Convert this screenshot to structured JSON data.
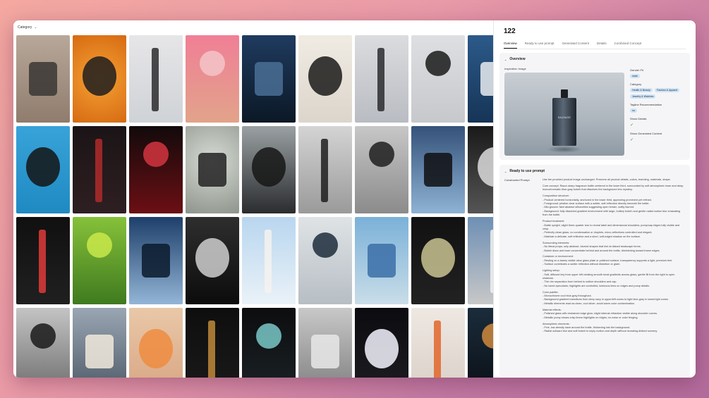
{
  "filter": {
    "label": "Category"
  },
  "tiles": [
    {
      "bg": "linear-gradient(180deg,#b8a89a,#8f7c6d)",
      "obj": "#3a3634"
    },
    {
      "bg": "radial-gradient(circle at 50% 50%,#f6a234,#d66a12)",
      "obj": "#1e1d1e"
    },
    {
      "bg": "linear-gradient(180deg,#e6e6e8,#cfd2d6)",
      "obj": "#2c2c2e"
    },
    {
      "bg": "linear-gradient(180deg,#f07f96,#e2a38a)",
      "obj": "#f3c4c9"
    },
    {
      "bg": "linear-gradient(180deg,#1f3b5f,#0b1826)",
      "obj": "#4a6f95"
    },
    {
      "bg": "linear-gradient(180deg,#f0ebe3,#dcd5cc)",
      "obj": "#1b1a19"
    },
    {
      "bg": "linear-gradient(180deg,#dbdcdf,#b9bcc2)",
      "obj": "#2a2b2e"
    },
    {
      "bg": "linear-gradient(180deg,#dedfe2,#c6c8cc)",
      "obj": "#1a1a1a"
    },
    {
      "bg": "linear-gradient(180deg,#2c5a8a,#163456)",
      "obj": "#e9ecf0"
    },
    {
      "bg": "linear-gradient(180deg,#38a3d8,#1f8ac2)",
      "obj": "#141414"
    },
    {
      "bg": "linear-gradient(180deg,#1b1416,#2e1f22)",
      "obj": "#b22a2a"
    },
    {
      "bg": "linear-gradient(180deg,#120a0b,#6c0f14)",
      "obj": "#d23540"
    },
    {
      "bg": "radial-gradient(circle at 50% 40%,#d7dbd5,#8e948c)",
      "obj": "#222"
    },
    {
      "bg": "linear-gradient(180deg,#9aa0a3,#2a2c2e)",
      "obj": "#161616"
    },
    {
      "bg": "linear-gradient(180deg,#d4d4d4,#9a9a9a)",
      "obj": "#1f1f1f"
    },
    {
      "bg": "linear-gradient(180deg,#c7c7c7,#8b8b8b)",
      "obj": "#1e1e1e"
    },
    {
      "bg": "linear-gradient(180deg,#35527a,#8eb3d4)",
      "obj": "#0f0f12"
    },
    {
      "bg": "linear-gradient(180deg,#1a1a1a,#555)",
      "obj": "#dcdcdc"
    },
    {
      "bg": "linear-gradient(180deg,#101010,#202020)",
      "obj": "#e23a3a"
    },
    {
      "bg": "linear-gradient(180deg,#86c13a,#3f7a1f)",
      "obj": "#c9e94a"
    },
    {
      "bg": "linear-gradient(180deg,#1d3f6a,#93b5d6)",
      "obj": "#0b1a2c"
    },
    {
      "bg": "linear-gradient(180deg,#2e2e2e,#0c0c0c)",
      "obj": "#cfcfcf"
    },
    {
      "bg": "linear-gradient(180deg,#b9d6ef,#eaf2f8)",
      "obj": "#f4f2ee"
    },
    {
      "bg": "linear-gradient(180deg,#dfe3e6,#b7bec4)",
      "obj": "#1d2d3c"
    },
    {
      "bg": "linear-gradient(180deg,#7bb1d8,#c9dde8)",
      "obj": "#3b6ea8"
    },
    {
      "bg": "linear-gradient(180deg,#111,#222)",
      "obj": "#c9c391"
    },
    {
      "bg": "linear-gradient(180deg,#6e8fb4,#c8c8c8)",
      "obj": "#f0f0f0"
    },
    {
      "bg": "linear-gradient(180deg,#c4c4c4,#6c6c6c)",
      "obj": "#1a1a1a"
    },
    {
      "bg": "linear-gradient(180deg,#9aa6b3,#4c5966)",
      "obj": "#f1e9dc"
    },
    {
      "bg": "linear-gradient(180deg,#e9c8a8,#d8a583)",
      "obj": "#ef8c40"
    },
    {
      "bg": "linear-gradient(180deg,#0e0e0e,#1a1a1a)",
      "obj": "#c08a3a"
    },
    {
      "bg": "linear-gradient(180deg,#0d0d0f,#1a2226)",
      "obj": "#7ac8c8"
    },
    {
      "bg": "linear-gradient(180deg,#c8c8c8,#7f7f7f)",
      "obj": "#e8e8e8"
    },
    {
      "bg": "linear-gradient(180deg,#0c0c10,#1d1d22)",
      "obj": "#f5f5ff"
    },
    {
      "bg": "linear-gradient(180deg,#efe8e2,#d8cfc6)",
      "obj": "#e2662a"
    },
    {
      "bg": "linear-gradient(180deg,#1b2c3b,#0a0f15)",
      "obj": "#d08a3c"
    }
  ],
  "detail": {
    "title": "122",
    "tabs": [
      "Overview",
      "Ready to use prompt",
      "Generated Content",
      "Details",
      "Combined Concept"
    ],
    "overview": {
      "heading": "Overview",
      "inspiration_label": "Inspiration Image",
      "bottle_label": "SAUVAGE",
      "gender_fit_label": "Gender Fit",
      "gender_fit": [
        "male"
      ],
      "category_label": "Category",
      "categories": [
        "Health & Beauty",
        "Fashion & Apparel",
        "Jewelry & Watches"
      ],
      "tagline_label": "Tagline Recommendation",
      "tagline": [
        "no"
      ],
      "show_details_label": "Show Details",
      "show_generated_label": "Show Generated Content"
    },
    "prompt": {
      "heading": "Ready to use prompt",
      "constructed_label": "Constructed Prompt",
      "paragraphs": [
        "Use the provided product image unchanged. Preserve all product details, colors, branding, materials, shape.",
        "Core concept: Razor-sharp fragrance bottle centered in the lower third, surrounded by soft atmospheric haze and deep, monochromatic blue-gray bokeh that dissolves the background into mystery.",
        "Composition structure:\n- Product centered horizontally, anchored in the lower third, appearing prominent yet refined.\n- Foreground: pristine clear surface with a subtle, soft reflection directly beneath the bottle.\n- Mid-ground: faint abstract silhouettes suggesting open terrain, softly blurred.\n- Background: fully dissolved gradient environment with large, buttery bokeh and gentle radial motion blur emanating from the bottle.",
        "Product treatment:\n- Bottle upright, slight three-quarter turn to reveal label and dimensional shoulders; pump/cap ridges fully visible and crisp.\n- Perfectly clean glass, no condensation or droplets, micro-reflections controlled and elegant.\n- Maintain a delicate, soft reflection and a short, soft-edged shadow on the surface.",
        "Surrounding elements:\n- No literal props; only abstract, blurred shapes that hint at distant landscape forms.\n- Bokeh discs and haze concentrate behind and around the bottle, diminishing toward frame edges.",
        "Container or environment:\n- Resting on a barely visible clear glass plate or polished surface; transparency supports a light, premium feel.\n- Surface contributes a subtle reflection without distortion or glare.",
        "Lighting setup:\n- Soft, diffused key from upper left creating smooth tonal gradients across glass; gentle fill from the right to open shadows.\n- Thin rim separation from behind to outline shoulders and cap.\n- No harsh specularis; highlights are controlled, luminous lines on edges and pump details.",
        "Color palette:\n- Monochrome cool blue-gray throughout.\n- Background gradient transitions from deep navy in upper/left zones to light blue-gray in lower/right zones.\n- Metallic elements read as clean, cool silver; avoid warm color contamination.",
        "Material effects:\n- Polished glass with restrained edge glow; slight internal refraction visible along shoulder curves.\n- Metallic pump shows crisp linear highlights on ridges; no noise or color fringing.",
        "Atmospheric elements:\n- Fine, low-density haze around the bottle, thickening into the background.\n- Radial outward blur and soft bokeh to imply motion and depth without revealing distinct scenery."
      ]
    }
  }
}
